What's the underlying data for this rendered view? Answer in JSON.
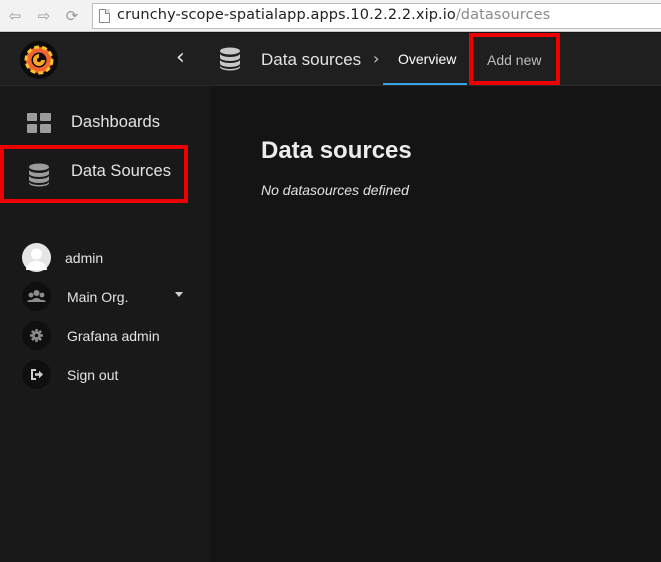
{
  "browser": {
    "url_host": "crunchy-scope-spatialapp.apps.10.2.2.2.xip.io",
    "url_path": "/datasources"
  },
  "topnav": {
    "section_title": "Data sources",
    "tabs": [
      {
        "label": "Overview",
        "active": true
      },
      {
        "label": "Add new",
        "active": false
      }
    ]
  },
  "sidebar": {
    "items": [
      {
        "label": "Dashboards",
        "icon": "grid-icon"
      },
      {
        "label": "Data Sources",
        "icon": "database-icon"
      }
    ],
    "user_menu": [
      {
        "label": "admin",
        "icon": "avatar"
      },
      {
        "label": "Main Org.",
        "icon": "users-icon"
      },
      {
        "label": "Grafana admin",
        "icon": "gear-icon"
      },
      {
        "label": "Sign out",
        "icon": "sign-out-icon"
      }
    ]
  },
  "main": {
    "title": "Data sources",
    "empty_message": "No datasources defined"
  },
  "colors": {
    "accent": "#33a2e5",
    "highlight_box": "#ee0000"
  }
}
